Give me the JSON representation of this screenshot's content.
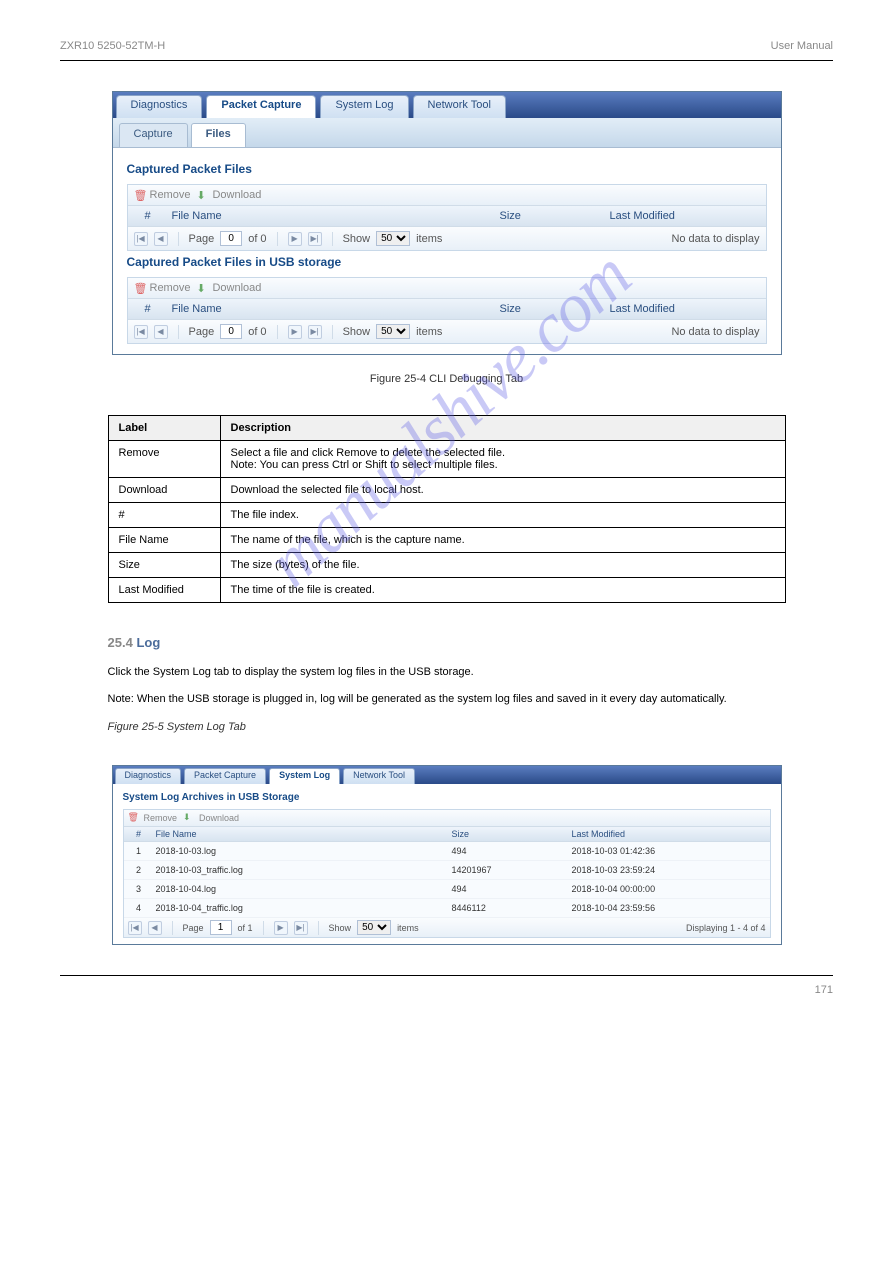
{
  "header": {
    "model": "ZXR10 5250-52TM-H",
    "doc": "User Manual"
  },
  "watermark": "manualshive.com",
  "figure1": {
    "caption": "Figure 25-4  CLI Debugging Tab",
    "main_tabs": [
      "Diagnostics",
      "Packet Capture",
      "System Log",
      "Network Tool"
    ],
    "main_active": 1,
    "sub_tabs": [
      "Capture",
      "Files"
    ],
    "sub_active": 1,
    "sections": [
      {
        "title": "Captured Packet Files",
        "toolbar": {
          "remove": "Remove",
          "download": "Download"
        },
        "columns": {
          "num": "#",
          "file": "File Name",
          "size": "Size",
          "mod": "Last Modified"
        },
        "pager": {
          "page_label": "Page",
          "page": "0",
          "of": "of 0",
          "show": "Show",
          "pagesize": "50",
          "items": "items",
          "nodata": "No data to display"
        },
        "rows": []
      },
      {
        "title": "Captured Packet Files in USB storage",
        "toolbar": {
          "remove": "Remove",
          "download": "Download"
        },
        "columns": {
          "num": "#",
          "file": "File Name",
          "size": "Size",
          "mod": "Last Modified"
        },
        "pager": {
          "page_label": "Page",
          "page": "0",
          "of": "of 0",
          "show": "Show",
          "pagesize": "50",
          "items": "items",
          "nodata": "No data to display"
        },
        "rows": []
      }
    ]
  },
  "labels_table": {
    "head": {
      "label": "Label",
      "desc": "Description"
    },
    "rows": [
      {
        "label": "Remove",
        "desc": "Select a file and click Remove to delete the selected file.\nNote: You can press Ctrl or Shift to select multiple files."
      },
      {
        "label": "Download",
        "desc": "Download the selected file to local host."
      },
      {
        "label": "#",
        "desc": "The file index."
      },
      {
        "label": "File Name",
        "desc": "The name of the file, which is the capture name."
      },
      {
        "label": "Size",
        "desc": "The size (bytes) of the file."
      },
      {
        "label": "Last Modified",
        "desc": "The time of the file is created."
      }
    ]
  },
  "section": {
    "num": "25.4",
    "title": "Log",
    "p1": "Click the System Log tab to display the system log files in the USB storage.",
    "note": "Note: When the USB storage is plugged in, log will be generated as the system log files and saved in it every day automatically."
  },
  "figure2": {
    "caption": "Figure 25-5  System Log Tab",
    "main_tabs": [
      "Diagnostics",
      "Packet Capture",
      "System Log",
      "Network Tool"
    ],
    "main_active": 2,
    "section_title": "System Log Archives in USB Storage",
    "toolbar": {
      "remove": "Remove",
      "download": "Download"
    },
    "columns": {
      "num": "#",
      "file": "File Name",
      "size": "Size",
      "mod": "Last Modified"
    },
    "rows": [
      {
        "num": "1",
        "file": "2018-10-03.log",
        "size": "494",
        "mod": "2018-10-03 01:42:36"
      },
      {
        "num": "2",
        "file": "2018-10-03_traffic.log",
        "size": "14201967",
        "mod": "2018-10-03 23:59:24"
      },
      {
        "num": "3",
        "file": "2018-10-04.log",
        "size": "494",
        "mod": "2018-10-04 00:00:00"
      },
      {
        "num": "4",
        "file": "2018-10-04_traffic.log",
        "size": "8446112",
        "mod": "2018-10-04 23:59:56"
      }
    ],
    "pager": {
      "page_label": "Page",
      "page": "1",
      "of": "of 1",
      "show": "Show",
      "pagesize": "50",
      "items": "items",
      "displaying": "Displaying 1 - 4 of 4"
    }
  },
  "footer": {
    "page": "171"
  }
}
